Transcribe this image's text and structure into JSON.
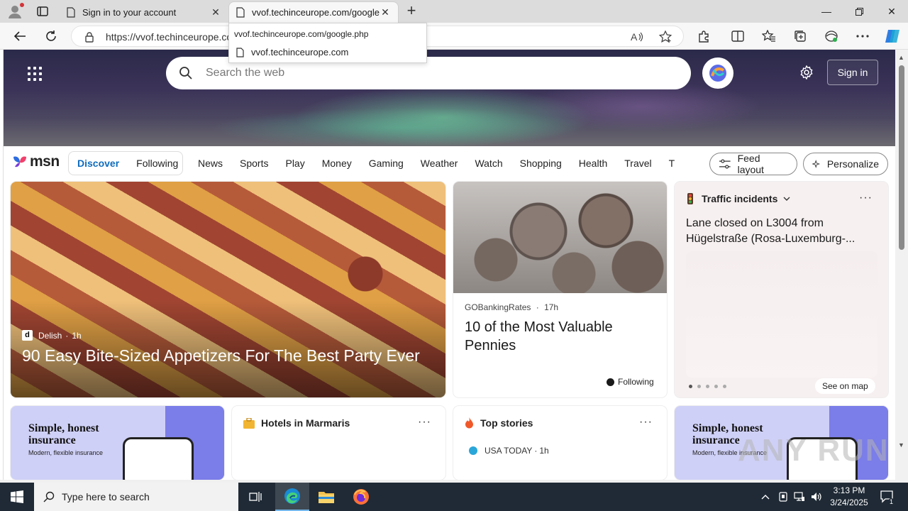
{
  "browser": {
    "tabs": [
      {
        "title": "Sign in to your account",
        "active": false
      },
      {
        "title": "vvof.techinceurope.com/google.php",
        "active": true
      }
    ],
    "address": "https://vvof.techinceurope.com/google.php",
    "dropdown": {
      "full_url": "vvof.techinceurope.com/google.php",
      "suggestion": "vvof.techinceurope.com"
    }
  },
  "hero": {
    "search_placeholder": "Search the web",
    "signin_label": "Sign in"
  },
  "msn": {
    "logo_text": "msn",
    "pills": [
      "Discover",
      "Following"
    ],
    "nav": [
      "News",
      "Sports",
      "Play",
      "Money",
      "Gaming",
      "Weather",
      "Watch",
      "Shopping",
      "Health",
      "Travel",
      "Trat"
    ],
    "feed_layout_label": "Feed layout",
    "personalize_label": "Personalize"
  },
  "cards": {
    "big": {
      "source": "Delish",
      "source_letter": "d",
      "time": "1h",
      "headline": "90 Easy Bite-Sized Appetizers For The Best Party Ever"
    },
    "coins": {
      "source": "GOBankingRates",
      "time": "17h",
      "headline": "10 of the Most Valuable Pennies",
      "following_label": "Following"
    },
    "traffic": {
      "title": "Traffic incidents",
      "headline": "Lane closed on L3004 from Hügelstraße (Rosa-Luxemburg-...",
      "see_map": "See on map"
    },
    "insurance": {
      "line1": "Simple, honest insurance",
      "line2": "Modern, flexible insurance"
    },
    "hotels": {
      "title": "Hotels in Marmaris"
    },
    "top_stories": {
      "title": "Top stories",
      "source": "USA TODAY",
      "time": "1h"
    }
  },
  "watermark": "ANY RUN",
  "taskbar": {
    "search_placeholder": "Type here to search",
    "time": "3:13 PM",
    "date": "3/24/2025",
    "notifications": "1"
  },
  "colors": {
    "accent": "#0f6cbd",
    "taskbar": "#1f2a36"
  }
}
